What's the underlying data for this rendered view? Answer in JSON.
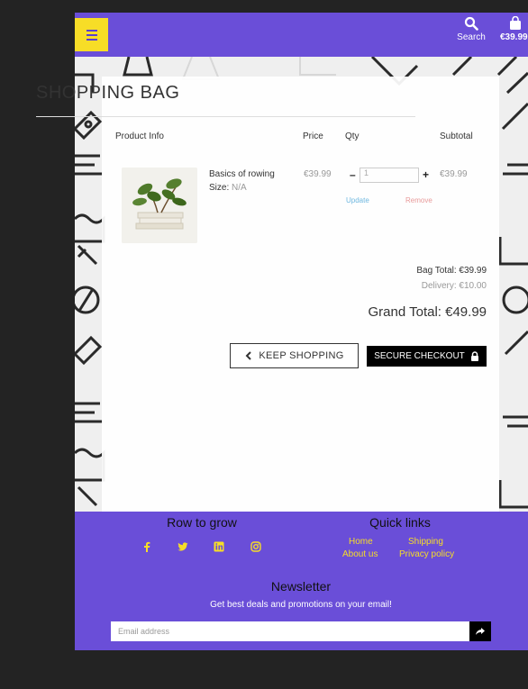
{
  "header": {
    "search_label": "Search",
    "bag_total": "€39.99"
  },
  "bag": {
    "title": "SHOPPING BAG",
    "columns": {
      "product": "Product Info",
      "price": "Price",
      "qty": "Qty",
      "subtotal": "Subtotal"
    },
    "item": {
      "name": "Basics of rowing",
      "size_label": "Size:",
      "size_value": "N/A",
      "price": "€39.99",
      "qty": "1",
      "subtotal": "€39.99",
      "update": "Update",
      "remove": "Remove"
    },
    "bag_total": "Bag Total: €39.99",
    "delivery": "Delivery: €10.00",
    "grand_total": "Grand Total: €49.99",
    "keep_shopping": "KEEP SHOPPING",
    "secure_checkout": "SECURE CHECKOUT"
  },
  "footer": {
    "brand": "Row to grow",
    "quick_links_title": "Quick links",
    "links": {
      "home": "Home",
      "shipping": "Shipping",
      "about": "About us",
      "privacy": "Privacy policy"
    },
    "newsletter_title": "Newsletter",
    "newsletter_text": "Get best deals and promotions on your email!",
    "email_placeholder": "Email address"
  },
  "colors": {
    "brand": "#6a4ed8",
    "accent": "#f7dd27"
  },
  "icons": [
    "menu-icon",
    "search-icon",
    "bag-icon",
    "chevron-left-icon",
    "lock-icon",
    "facebook-icon",
    "twitter-icon",
    "linkedin-icon",
    "instagram-icon",
    "share-arrow-icon"
  ]
}
